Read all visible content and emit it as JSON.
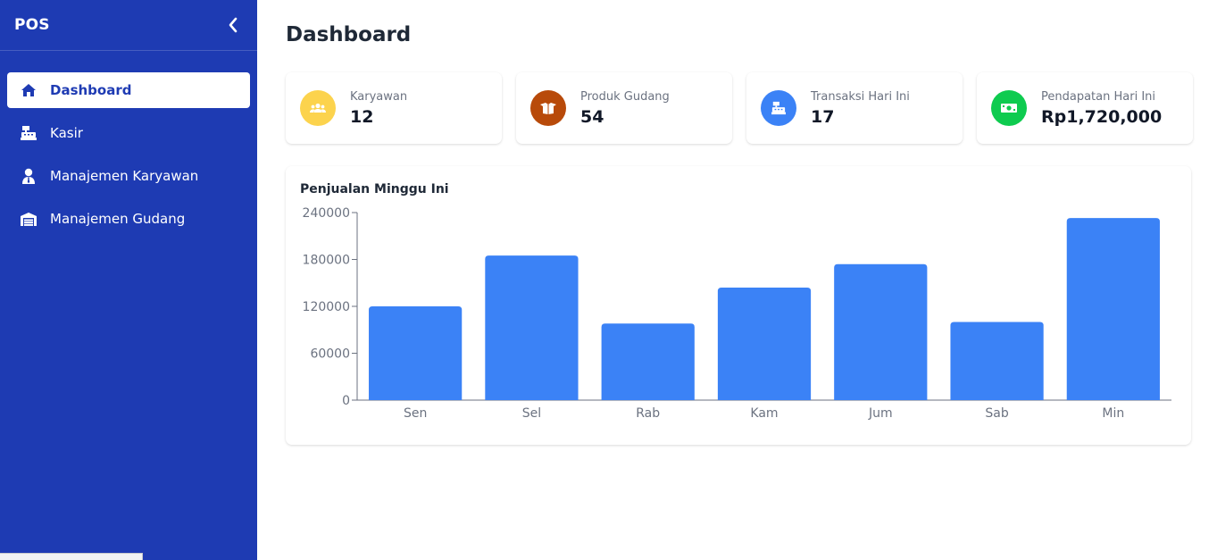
{
  "sidebar": {
    "brand": "POS",
    "collapse_icon": "chevron-left-icon",
    "items": [
      {
        "label": "Dashboard",
        "icon": "home-icon",
        "active": true
      },
      {
        "label": "Kasir",
        "icon": "cash-register-icon",
        "active": false
      },
      {
        "label": "Manajemen Karyawan",
        "icon": "user-tie-icon",
        "active": false
      },
      {
        "label": "Manajemen Gudang",
        "icon": "warehouse-icon",
        "active": false
      }
    ]
  },
  "page": {
    "title": "Dashboard"
  },
  "stats": [
    {
      "label": "Karyawan",
      "value": "12",
      "icon": "users-icon",
      "color": "#fcd34d"
    },
    {
      "label": "Produk Gudang",
      "value": "54",
      "icon": "box-icon",
      "color": "#b84a0a"
    },
    {
      "label": "Transaksi Hari Ini",
      "value": "17",
      "icon": "cash-register-icon",
      "color": "#3b82f6"
    },
    {
      "label": "Pendapatan Hari Ini",
      "value": "Rp1,720,000",
      "icon": "money-bill-icon",
      "color": "#0ecb4f"
    }
  ],
  "colors": {
    "sidebar": "#1e3bb3",
    "bar": "#3b82f6"
  },
  "chart_data": {
    "type": "bar",
    "title": "Penjualan Minggu Ini",
    "categories": [
      "Sen",
      "Sel",
      "Rab",
      "Kam",
      "Jum",
      "Sab",
      "Min"
    ],
    "values": [
      120000,
      185000,
      98000,
      144000,
      174000,
      100000,
      233000
    ],
    "ylim": [
      0,
      240000
    ],
    "yticks": [
      "0",
      "60000",
      "120000",
      "180000",
      "240000"
    ],
    "grid": false,
    "legend": "none"
  }
}
